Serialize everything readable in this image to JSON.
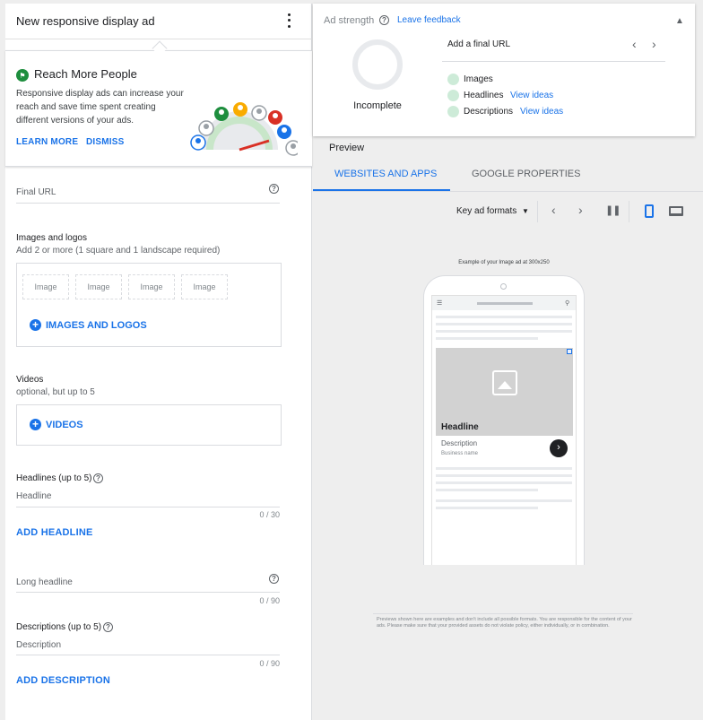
{
  "left": {
    "title": "New responsive display ad",
    "tip": {
      "title": "Reach More People",
      "body": "Responsive display ads can increase your reach and save time spent creating different versions of your ads.",
      "learn_more": "LEARN MORE",
      "dismiss": "DISMISS"
    },
    "final_url": {
      "placeholder": "Final URL"
    },
    "images": {
      "title": "Images and logos",
      "subtitle": "Add 2 or more (1 square and 1 landscape required)",
      "slots": [
        "Image",
        "Image",
        "Image",
        "Image"
      ],
      "button": "IMAGES AND LOGOS"
    },
    "videos": {
      "title": "Videos",
      "subtitle": "optional, but up to 5",
      "button": "VIDEOS"
    },
    "headlines": {
      "title": "Headlines (up to 5)",
      "placeholder": "Headline",
      "counter": "0 / 30",
      "add": "ADD HEADLINE"
    },
    "long_headline": {
      "placeholder": "Long headline",
      "counter": "0 / 90"
    },
    "descriptions": {
      "title": "Descriptions (up to 5)",
      "placeholder": "Description",
      "counter": "0 / 90",
      "add": "ADD DESCRIPTION"
    }
  },
  "strength": {
    "title": "Ad strength",
    "feedback": "Leave feedback",
    "status": "Incomplete",
    "tip": "Add a final URL",
    "items": [
      {
        "label": "Images",
        "link": ""
      },
      {
        "label": "Headlines",
        "link": "View ideas"
      },
      {
        "label": "Descriptions",
        "link": "View ideas"
      }
    ]
  },
  "preview": {
    "title": "Preview",
    "tabs": [
      "WEBSITES AND APPS",
      "GOOGLE PROPERTIES"
    ],
    "formats": "Key ad formats",
    "example_caption": "Example of your Image ad at 300x250",
    "ad": {
      "headline": "Headline",
      "description": "Description",
      "business": "Business name"
    },
    "disclaimer": "Previews shown here are examples and don't include all possible formats. You are responsible for the content of your ads. Please make sure that your provided assets do not violate policy, either individually, or in combination."
  },
  "colors": {
    "accent": "#1a73e8",
    "success": "#1e8e3e",
    "pending": "#cdebd8"
  }
}
